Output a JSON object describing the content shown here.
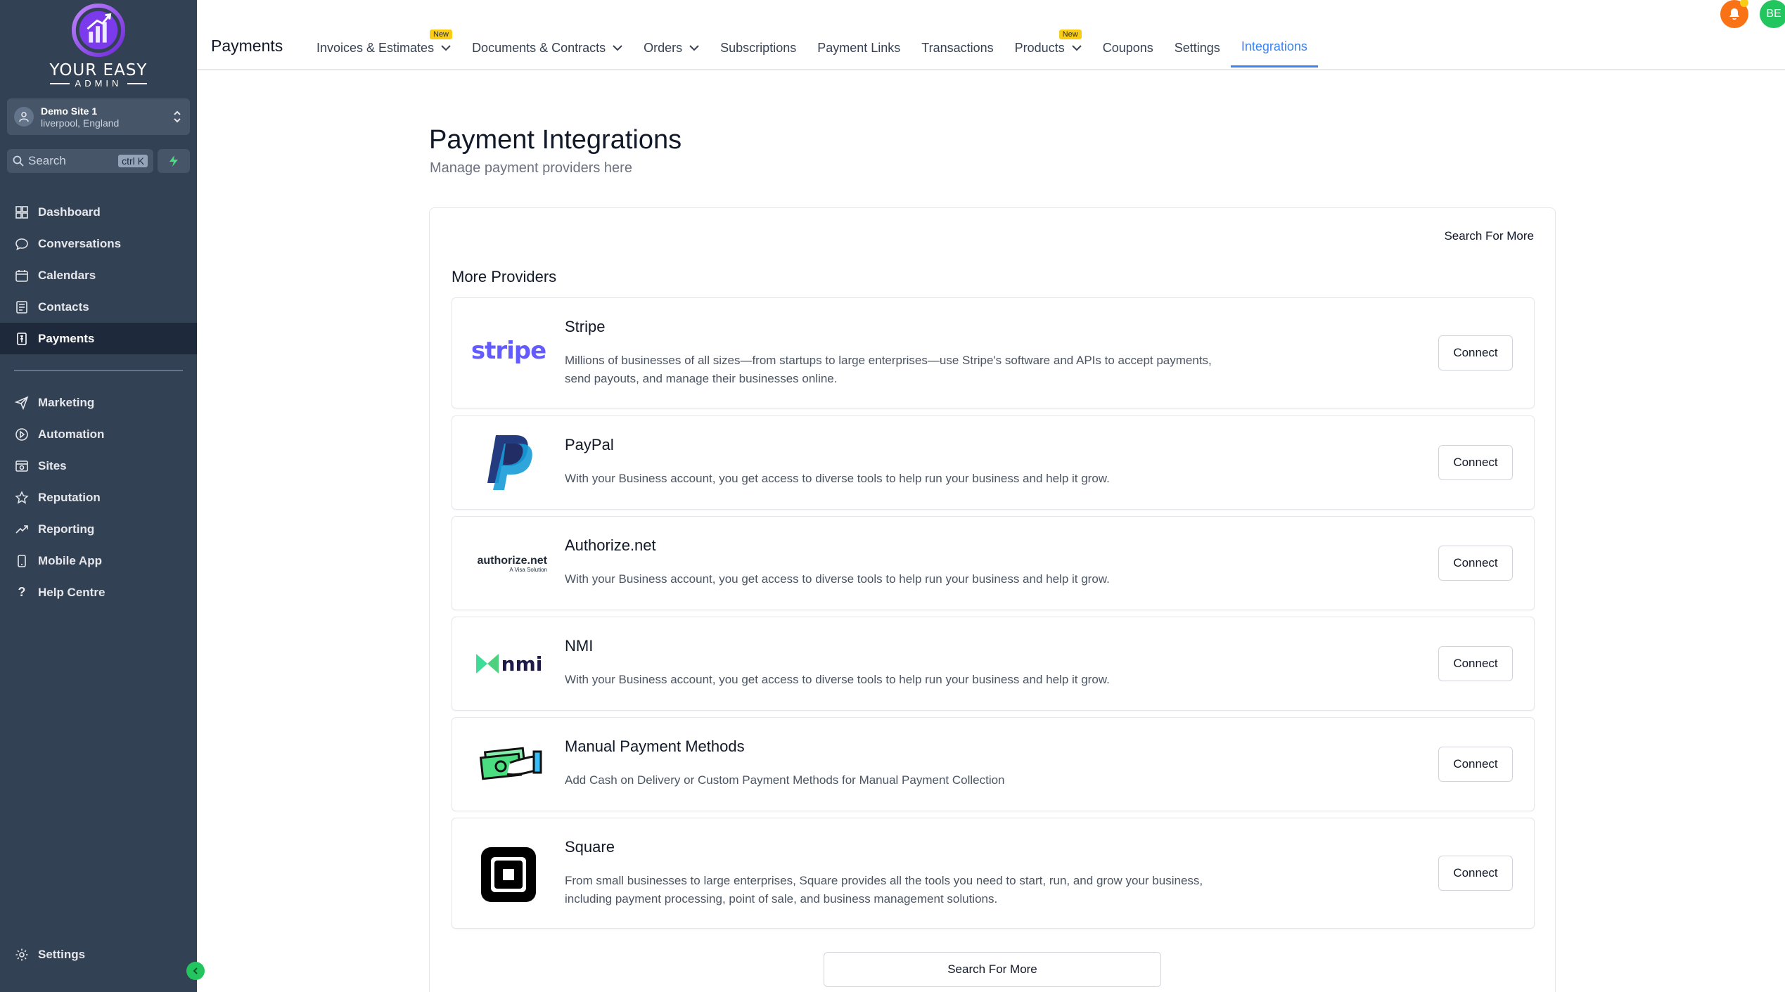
{
  "brand": {
    "line1": "YOUR EASY",
    "line2": "ADMIN"
  },
  "site": {
    "name": "Demo Site 1",
    "location": "liverpool, England"
  },
  "search": {
    "placeholder": "Search",
    "shortcut": "ctrl K"
  },
  "sidebar": {
    "items": [
      {
        "label": "Dashboard",
        "icon": "dashboard-icon"
      },
      {
        "label": "Conversations",
        "icon": "chat-icon"
      },
      {
        "label": "Calendars",
        "icon": "calendar-icon"
      },
      {
        "label": "Contacts",
        "icon": "contacts-icon"
      },
      {
        "label": "Payments",
        "icon": "payments-icon",
        "active": true
      }
    ],
    "items2": [
      {
        "label": "Marketing",
        "icon": "send-icon"
      },
      {
        "label": "Automation",
        "icon": "automation-icon"
      },
      {
        "label": "Sites",
        "icon": "sites-icon"
      },
      {
        "label": "Reputation",
        "icon": "star-icon"
      },
      {
        "label": "Reporting",
        "icon": "trend-icon"
      },
      {
        "label": "Mobile App",
        "icon": "mobile-icon"
      },
      {
        "label": "Help Centre",
        "icon": "help-icon"
      }
    ],
    "settings_label": "Settings"
  },
  "header": {
    "title": "Payments",
    "tabs": [
      {
        "label": "Invoices & Estimates",
        "dropdown": true,
        "badge": "New"
      },
      {
        "label": "Documents & Contracts",
        "dropdown": true
      },
      {
        "label": "Orders",
        "dropdown": true
      },
      {
        "label": "Subscriptions"
      },
      {
        "label": "Payment Links"
      },
      {
        "label": "Transactions"
      },
      {
        "label": "Products",
        "dropdown": true,
        "badge": "New"
      },
      {
        "label": "Coupons"
      },
      {
        "label": "Settings"
      },
      {
        "label": "Integrations",
        "active": true
      }
    ],
    "user_initials": "BE"
  },
  "main": {
    "title": "Payment Integrations",
    "subtitle": "Manage payment providers here",
    "search_more_link": "Search For More",
    "section_title": "More Providers",
    "providers": [
      {
        "name": "Stripe",
        "logo_text": "stripe",
        "description": "Millions of businesses of all sizes—from startups to large enterprises—use Stripe's software and APIs to accept payments, send payouts, and manage their businesses online.",
        "button": "Connect"
      },
      {
        "name": "PayPal",
        "description": "With your Business account, you get access to diverse tools to help run your business and help it grow.",
        "button": "Connect"
      },
      {
        "name": "Authorize.net",
        "logo_text": "authorize.net",
        "logo_sub": "A Visa Solution",
        "description": "With your Business account, you get access to diverse tools to help run your business and help it grow.",
        "button": "Connect"
      },
      {
        "name": "NMI",
        "logo_text": "nmi",
        "description": "With your Business account, you get access to diverse tools to help run your business and help it grow.",
        "button": "Connect"
      },
      {
        "name": "Manual Payment Methods",
        "description": "Add Cash on Delivery or Custom Payment Methods for Manual Payment Collection",
        "button": "Connect"
      },
      {
        "name": "Square",
        "description": "From small businesses to large enterprises, Square provides all the tools you need to start, run, and grow your business, including payment processing, point of sale, and business management solutions.",
        "button": "Connect"
      }
    ],
    "search_more_button": "Search For More"
  },
  "colors": {
    "sidebar": "#334155",
    "accent": "#3b82f6",
    "stripe": "#635bff",
    "paypal_dark": "#253b80",
    "paypal_light": "#179bd7",
    "nmi_green": "#3ddc97",
    "nmi_navy": "#1e1b4b"
  }
}
